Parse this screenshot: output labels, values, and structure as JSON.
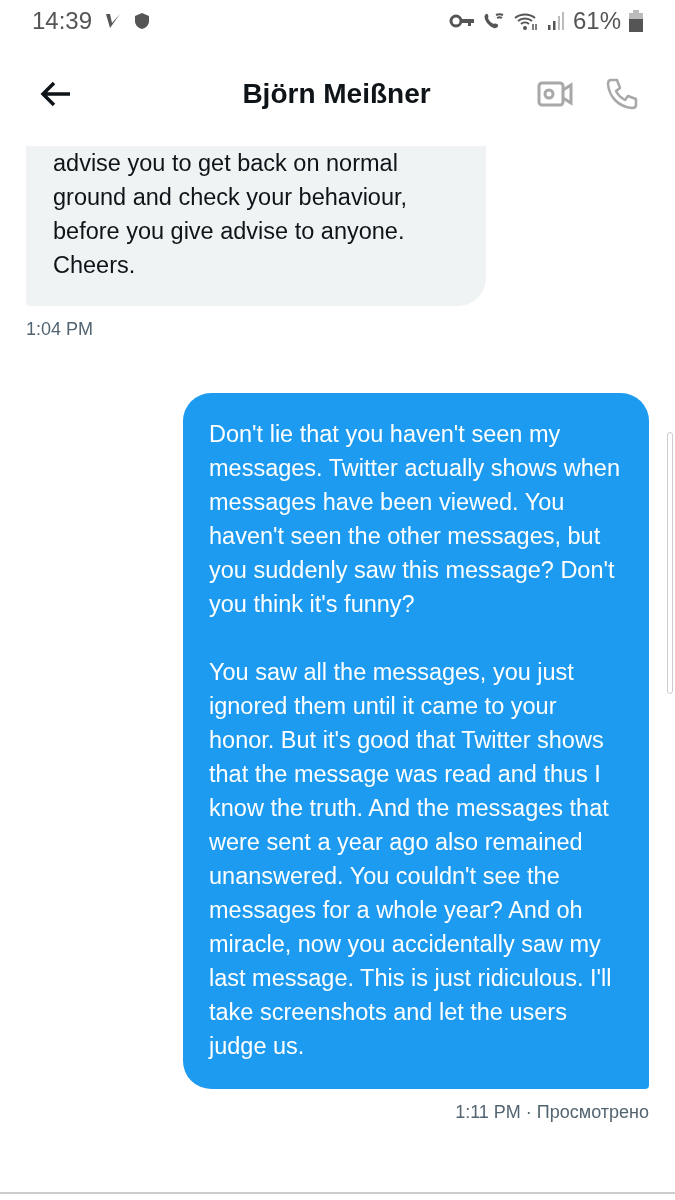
{
  "status_bar": {
    "time": "14:39",
    "battery": "61%"
  },
  "header": {
    "title": "Björn Meißner"
  },
  "messages": [
    {
      "kind": "received",
      "paragraphs": [
        "advise you to get back on normal ground and check your behaviour, before you give advise to anyone. Cheers."
      ],
      "meta": "1:04 PM"
    },
    {
      "kind": "sent",
      "paragraphs": [
        "Don't lie that you haven't seen my messages. Twitter actually shows when messages have been viewed. You haven't seen the other messages, but you suddenly saw this message? Don't you think it's funny?",
        "You saw all the messages, you just ignored them until it came to your honor. But it's good that Twitter shows that the message was read and thus I know the truth. And the messages that were sent a year ago also remained unanswered. You couldn't see the messages for a whole year? And oh miracle, now you accidentally saw my last message. This is just ridiculous. I'll take screenshots and let the users judge us."
      ],
      "meta": "1:11 PM · Просмотрено"
    }
  ]
}
